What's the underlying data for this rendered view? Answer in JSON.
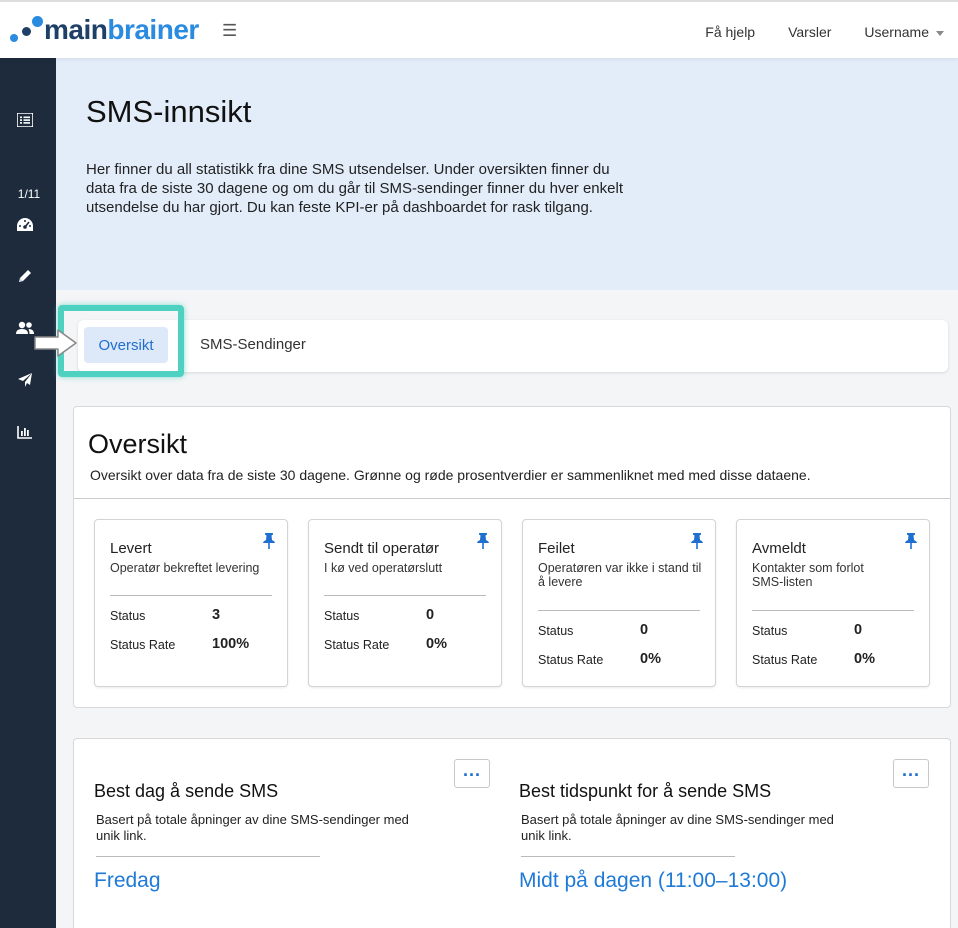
{
  "header": {
    "logo_main": "main",
    "logo_brainer": "brainer",
    "nav": [
      "Få hjelp",
      "Varsler",
      "Username"
    ]
  },
  "sidebar": {
    "counter": "1/11",
    "icons": [
      "list-icon",
      "dashboard-icon",
      "pencil-icon",
      "users-icon",
      "send-icon",
      "bar-chart-icon"
    ]
  },
  "hero": {
    "title": "SMS-innsikt",
    "description": "Her finner du all statistikk fra dine SMS utsendelser. Under oversikten finner du data fra de siste 30 dagene og om du går til SMS-sendinger finner du hver enkelt utsendelse du har gjort. Du kan feste KPI-er på dashboardet for rask tilgang."
  },
  "tabs": {
    "active": "Oversikt",
    "second": "SMS-Sendinger"
  },
  "overview": {
    "title": "Oversikt",
    "description": "Oversikt over data fra de siste 30 dagene. Grønne og røde prosentverdier er sammenliknet med med disse dataene.",
    "status_label": "Status",
    "rate_label": "Status Rate",
    "stats": [
      {
        "title": "Levert",
        "subtitle": "Operatør bekreftet levering",
        "status": "3",
        "rate": "100%"
      },
      {
        "title": "Sendt til operatør",
        "subtitle": "I kø ved operatørslutt",
        "status": "0",
        "rate": "0%"
      },
      {
        "title": "Feilet",
        "subtitle": "Operatøren var ikke i stand til å levere",
        "status": "0",
        "rate": "0%"
      },
      {
        "title": "Avmeldt",
        "subtitle": "Kontakter som forlot SMS-listen",
        "status": "0",
        "rate": "0%"
      }
    ]
  },
  "best": {
    "day": {
      "title": "Best dag å sende SMS",
      "description": "Basert på totale åpninger av dine SMS-sendinger med unik link.",
      "result": "Fredag"
    },
    "time": {
      "title": "Best tidspunkt for å sende SMS",
      "description": "Basert på totale åpninger av dine SMS-sendinger med unik link.",
      "result": "Midt på dagen (11:00–13:00)"
    },
    "more_label": "..."
  },
  "colors": {
    "accent": "#1f6fd1",
    "sidebar": "#1d2b3d",
    "highlight": "#4fd1c1",
    "hero_bg": "#e3edf9"
  }
}
